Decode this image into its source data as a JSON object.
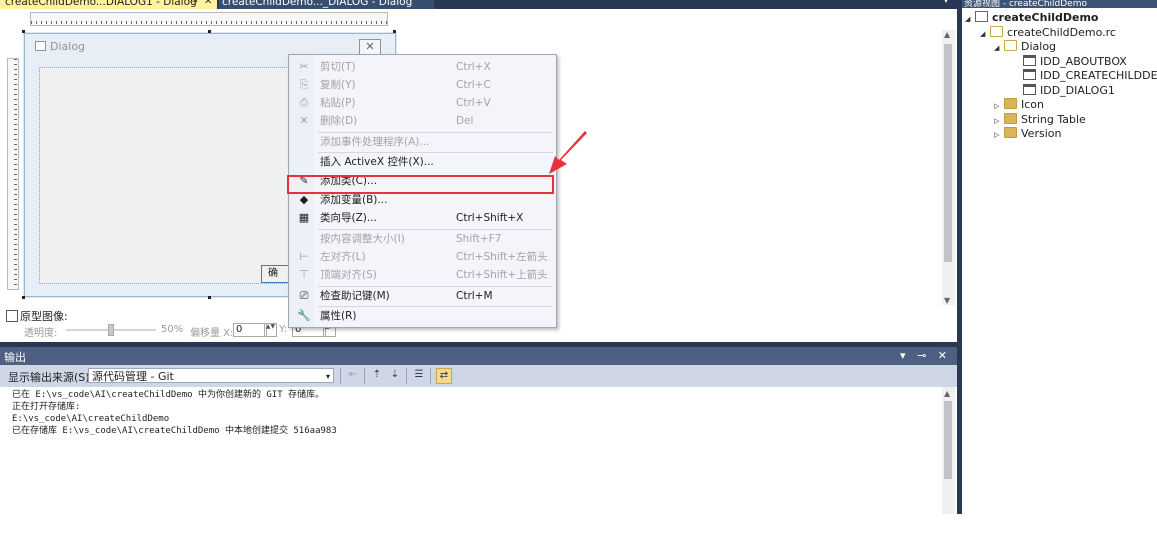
{
  "tabs": {
    "active": {
      "label": "createChildDemo...DIALOG1 - Dialog",
      "pin": "⊸",
      "close": "✕"
    },
    "inactive": {
      "label": "createChildDemo..._DIALOG - Dialog"
    },
    "menu_glyph": "▾"
  },
  "dialog": {
    "title": "Dialog",
    "close_glyph": "✕",
    "ok_button_partial": "确"
  },
  "context_menu": {
    "items": [
      {
        "icon": "✂",
        "label": "剪切(T)",
        "shortcut": "Ctrl+X",
        "enabled": false
      },
      {
        "icon": "⎘",
        "label": "复制(Y)",
        "shortcut": "Ctrl+C",
        "enabled": false
      },
      {
        "icon": "⎙",
        "label": "粘贴(P)",
        "shortcut": "Ctrl+V",
        "enabled": false
      },
      {
        "icon": "✕",
        "label": "删除(D)",
        "shortcut": "Del",
        "enabled": false
      },
      {
        "icon": "",
        "label": "添加事件处理程序(A)...",
        "shortcut": "",
        "enabled": false
      },
      {
        "icon": "",
        "label": "插入 ActiveX 控件(X)...",
        "shortcut": "",
        "enabled": true
      },
      {
        "icon": "✎",
        "label": "添加类(C)...",
        "shortcut": "",
        "enabled": true
      },
      {
        "icon": "◆",
        "label": "添加变量(B)...",
        "shortcut": "",
        "enabled": true
      },
      {
        "icon": "▦",
        "label": "类向导(Z)...",
        "shortcut": "Ctrl+Shift+X",
        "enabled": true
      },
      {
        "icon": "",
        "label": "按内容调整大小(I)",
        "shortcut": "Shift+F7",
        "enabled": false
      },
      {
        "icon": "⊢",
        "label": "左对齐(L)",
        "shortcut": "Ctrl+Shift+左箭头",
        "enabled": false
      },
      {
        "icon": "⊤",
        "label": "顶端对齐(S)",
        "shortcut": "Ctrl+Shift+上箭头",
        "enabled": false
      },
      {
        "icon": "⎚",
        "label": "检查助记键(M)",
        "shortcut": "Ctrl+M",
        "enabled": true
      },
      {
        "icon": "🔧",
        "label": "属性(R)",
        "shortcut": "",
        "enabled": true
      }
    ]
  },
  "prototype": {
    "checkbox_label": "原型图像:",
    "opacity_label": "透明度:",
    "opacity_value": "50%",
    "offset_label": "偏移量 X:",
    "offset_x": "0",
    "y_label": "Y:",
    "offset_y": "0",
    "spin_glyph": "▲▼"
  },
  "output": {
    "title": "输出",
    "controls": "▾ ⊸ ✕",
    "source_label": "显示输出来源(S):",
    "source_value": "源代码管理 - Git",
    "dropdown_glyph": "▾",
    "lines": [
      "已在 E:\\vs_code\\AI\\createChildDemo 中为你创建新的 GIT 存储库。",
      "正在打开存储库:",
      "E:\\vs_code\\AI\\createChildDemo",
      "已在存储库 E:\\vs_code\\AI\\createChildDemo 中本地创建提交 516aa983"
    ]
  },
  "resource_view": {
    "header": "资源视图 - createChildDemo",
    "tree": [
      {
        "label": "createChildDemo",
        "twisty": "◢",
        "icon": "project",
        "bold": true
      },
      {
        "label": "createChildDemo.rc",
        "twisty": "◢",
        "icon": "folder-open",
        "bold": false
      },
      {
        "label": "Dialog",
        "twisty": "◢",
        "icon": "folder-open",
        "bold": false
      },
      {
        "label": "IDD_ABOUTBOX",
        "twisty": "",
        "icon": "dialog",
        "bold": false
      },
      {
        "label": "IDD_CREATECHILDDEMO",
        "twisty": "",
        "icon": "dialog",
        "bold": false
      },
      {
        "label": "IDD_DIALOG1",
        "twisty": "",
        "icon": "dialog",
        "bold": false
      },
      {
        "label": "Icon",
        "twisty": "▷",
        "icon": "folder",
        "bold": false
      },
      {
        "label": "String Table",
        "twisty": "▷",
        "icon": "folder",
        "bold": false
      },
      {
        "label": "Version",
        "twisty": "▷",
        "icon": "folder",
        "bold": false
      }
    ]
  },
  "scroll_glyphs": {
    "up": "▲",
    "down": "▼"
  },
  "colors": {
    "highlight_box": "#e8313a",
    "active_tab": "#fff29d",
    "chrome_dark": "#293955"
  }
}
